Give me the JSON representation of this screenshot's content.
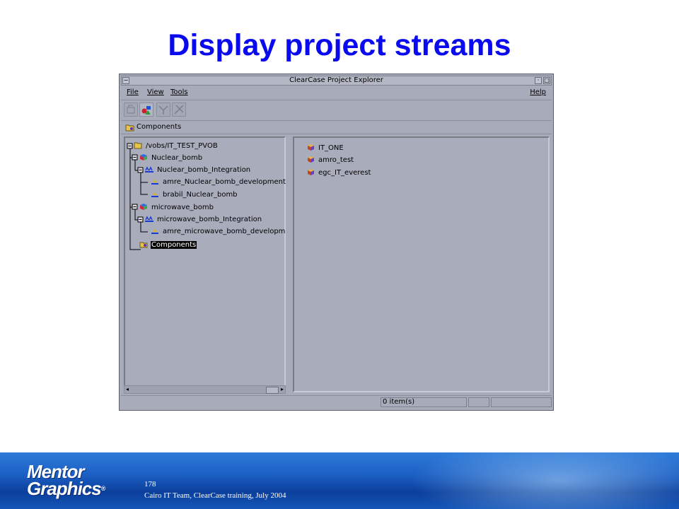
{
  "slide": {
    "title": "Display project streams",
    "page_number": "178",
    "caption": "Cairo IT Team, ClearCase training, July 2004",
    "logo_line1": "Mentor",
    "logo_line2": "Graphics"
  },
  "window": {
    "title": "ClearCase Project Explorer",
    "menu": {
      "file": "File",
      "view": "View",
      "tools": "Tools",
      "help": "Help"
    },
    "location_label": "Components",
    "tree": [
      {
        "label": "/vobs/IT_TEST_PVOB",
        "icon": "pvob-icon"
      },
      {
        "label": "Nuclear_bomb",
        "icon": "project-icon"
      },
      {
        "label": "Nuclear_bomb_Integration",
        "icon": "integration-stream-icon"
      },
      {
        "label": "amre_Nuclear_bomb_development",
        "icon": "stream-icon"
      },
      {
        "label": "brabil_Nuclear_bomb",
        "icon": "stream-icon"
      },
      {
        "label": "microwave_bomb",
        "icon": "project-icon"
      },
      {
        "label": "microwave_bomb_Integration",
        "icon": "integration-stream-icon"
      },
      {
        "label": "amre_microwave_bomb_developm",
        "icon": "stream-icon"
      },
      {
        "label": "Components",
        "icon": "components-icon",
        "selected": true
      }
    ],
    "components": [
      {
        "label": "IT_ONE",
        "icon": "component-icon"
      },
      {
        "label": "amro_test",
        "icon": "component-icon"
      },
      {
        "label": "egc_IT_everest",
        "icon": "component-icon"
      }
    ],
    "status": "0 item(s)",
    "colors": {
      "title_blue": "#0a0aee",
      "window_gray": "#a8abba"
    }
  }
}
